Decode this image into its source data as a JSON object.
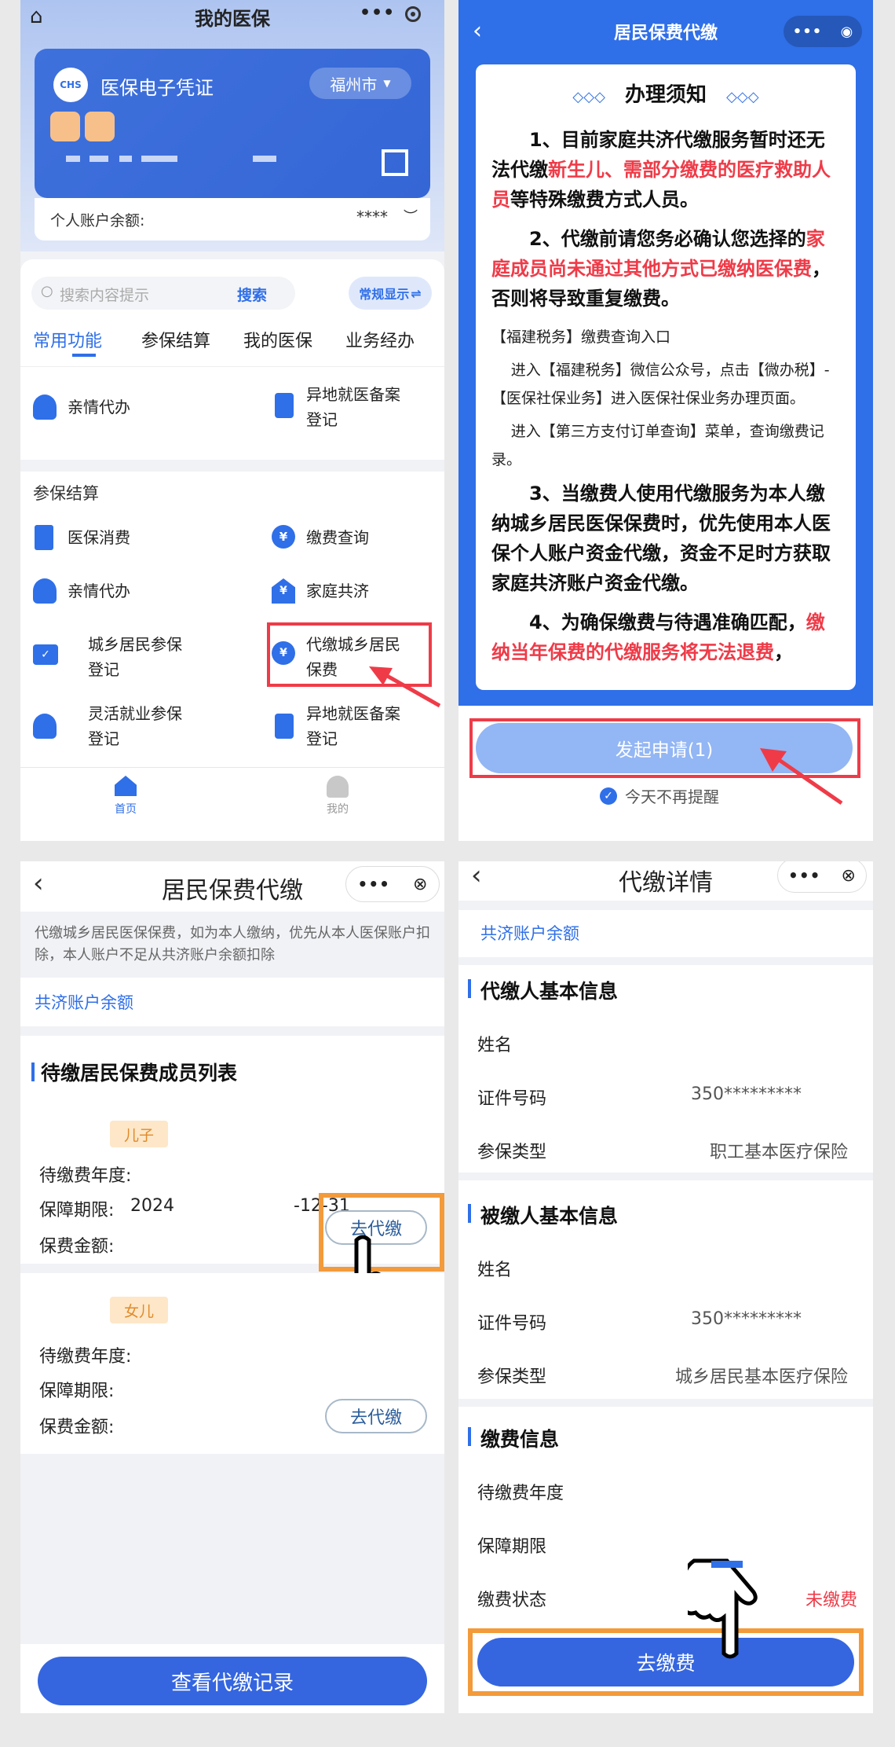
{
  "panel1": {
    "title": "我的医保",
    "card": {
      "title": "医保电子凭证",
      "logo_text": "CHS",
      "city": "福州市",
      "balance_label": "个人账户余额:",
      "balance_value": "****"
    },
    "search": {
      "placeholder": "搜索内容提示",
      "button": "搜索",
      "mode": "常规显示"
    },
    "tabs": [
      "常用功能",
      "参保结算",
      "我的医保",
      "业务经办"
    ],
    "common": [
      {
        "label": "亲情代办",
        "icon": "person-icon"
      },
      {
        "label1": "异地就医备案",
        "label2": "登记",
        "icon": "document-icon"
      }
    ],
    "section_title": "参保结算",
    "items": [
      {
        "label": "医保消费",
        "icon": "receipt-icon"
      },
      {
        "label": "缴费查询",
        "icon": "yen-search-icon"
      },
      {
        "label": "亲情代办",
        "icon": "person-icon"
      },
      {
        "label": "家庭共济",
        "icon": "house-icon"
      },
      {
        "label1": "城乡居民参保",
        "label2": "登记",
        "icon": "card-check-icon"
      },
      {
        "label1": "代缴城乡居民",
        "label2": "保费",
        "icon": "hand-yen-icon"
      },
      {
        "label1": "灵活就业参保",
        "label2": "登记",
        "icon": "person-icon"
      },
      {
        "label1": "异地就医备案",
        "label2": "登记",
        "icon": "document-icon"
      }
    ],
    "bottom_nav": [
      {
        "label": "首页",
        "icon": "home-icon"
      },
      {
        "label": "我的",
        "icon": "user-icon"
      }
    ]
  },
  "panel2": {
    "title": "居民保费代缴",
    "notice_title": "办理须知",
    "p1_a": "1、目前家庭共济代缴服务暂时还无法代缴",
    "p1_red": "新生儿、需部分缴费的医疗救助人员",
    "p1_b": "等特殊缴费方式人员。",
    "p2_a": "2、代缴前请您务必确认您选择的",
    "p2_red": "家庭成员尚未通过其他方式已缴纳医保费",
    "p2_b": "，否则将导致重复缴费。",
    "s1": "【福建税务】缴费查询入口",
    "s2": "进入【福建税务】微信公众号，点击【微办税】-【医保社保业务】进入医保社保业务办理页面。",
    "s3": "进入【第三方支付订单查询】菜单，查询缴费记录。",
    "p3": "3、当缴费人使用代缴服务为本人缴纳城乡居民医保保费时，优先使用本人医保个人账户资金代缴，资金不足时方获取家庭共济账户资金代缴。",
    "p4_a": "4、为确保缴费与待遇准确匹配，",
    "p4_red": "缴纳当年保费的代缴服务将无法退费",
    "p4_b": "，",
    "button": "发起申请(1)",
    "checkbox": "今天不再提醒"
  },
  "panel3": {
    "title": "居民保费代缴",
    "tip": "代缴城乡居民医保保费，如为本人缴纳，优先从本人医保账户扣除，本人账户不足从共济账户余额扣除",
    "balance_label": "共济账户余额",
    "list_title": "待缴居民保费成员列表",
    "members": [
      {
        "tag": "儿子",
        "year_label": "待缴费年度:",
        "period_label": "保障期限:",
        "period_value": "2024",
        "period_end": "-12-31",
        "amount_label": "保费金额:",
        "button": "去代缴"
      },
      {
        "tag": "女儿",
        "year_label": "待缴费年度:",
        "period_label": "保障期限:",
        "period_value": "",
        "period_end": "",
        "amount_label": "保费金额:",
        "button": "去代缴"
      }
    ],
    "bottom_button": "查看代缴记录"
  },
  "panel4": {
    "title": "代缴详情",
    "balance_label": "共济账户余额",
    "payer_title": "代缴人基本信息",
    "payer": [
      {
        "k": "姓名",
        "v": ""
      },
      {
        "k": "证件号码",
        "v": "350*********"
      },
      {
        "k": "参保类型",
        "v": "职工基本医疗保险"
      }
    ],
    "payee_title": "被缴人基本信息",
    "payee": [
      {
        "k": "姓名",
        "v": ""
      },
      {
        "k": "证件号码",
        "v": "350*********"
      },
      {
        "k": "参保类型",
        "v": "城乡居民基本医疗保险"
      }
    ],
    "pay_title": "缴费信息",
    "pay": [
      {
        "k": "待缴费年度",
        "v": ""
      },
      {
        "k": "保障期限",
        "v": ""
      },
      {
        "k": "缴费状态",
        "v": "未缴费"
      }
    ],
    "button": "去缴费"
  },
  "colors": {
    "primary": "#2f6fe8",
    "red": "#ef3b48",
    "orange": "#f39a3a",
    "tag_bg": "#fde7c8"
  }
}
